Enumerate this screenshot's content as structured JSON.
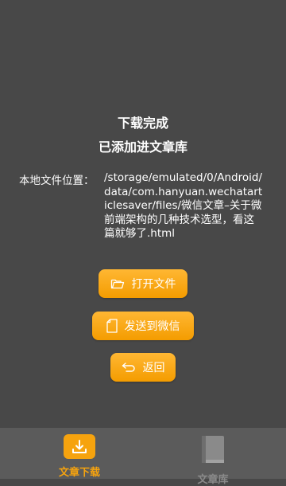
{
  "status": {
    "title": "下载完成",
    "subtitle": "已添加进文章库"
  },
  "file": {
    "location_label": "本地文件位置：",
    "location_path": "/storage/emulated/0/Android/data/com.hanyuan.wechatarticlesaver/files/微信文章–关于微前端架构的几种技术选型，看这篇就够了.html"
  },
  "actions": {
    "open_label": "打开文件",
    "send_label": "发送到微信",
    "back_label": "返回"
  },
  "nav": {
    "download_label": "文章下载",
    "library_label": "文章库"
  },
  "colors": {
    "accent": "#f6a30e",
    "background": "#484848",
    "nav_background": "#5b5b5b",
    "inactive": "#8a8a8a"
  },
  "icons": {
    "open": "folder-icon",
    "send": "document-icon",
    "back": "return-icon",
    "download": "download-icon",
    "library": "book-icon"
  }
}
